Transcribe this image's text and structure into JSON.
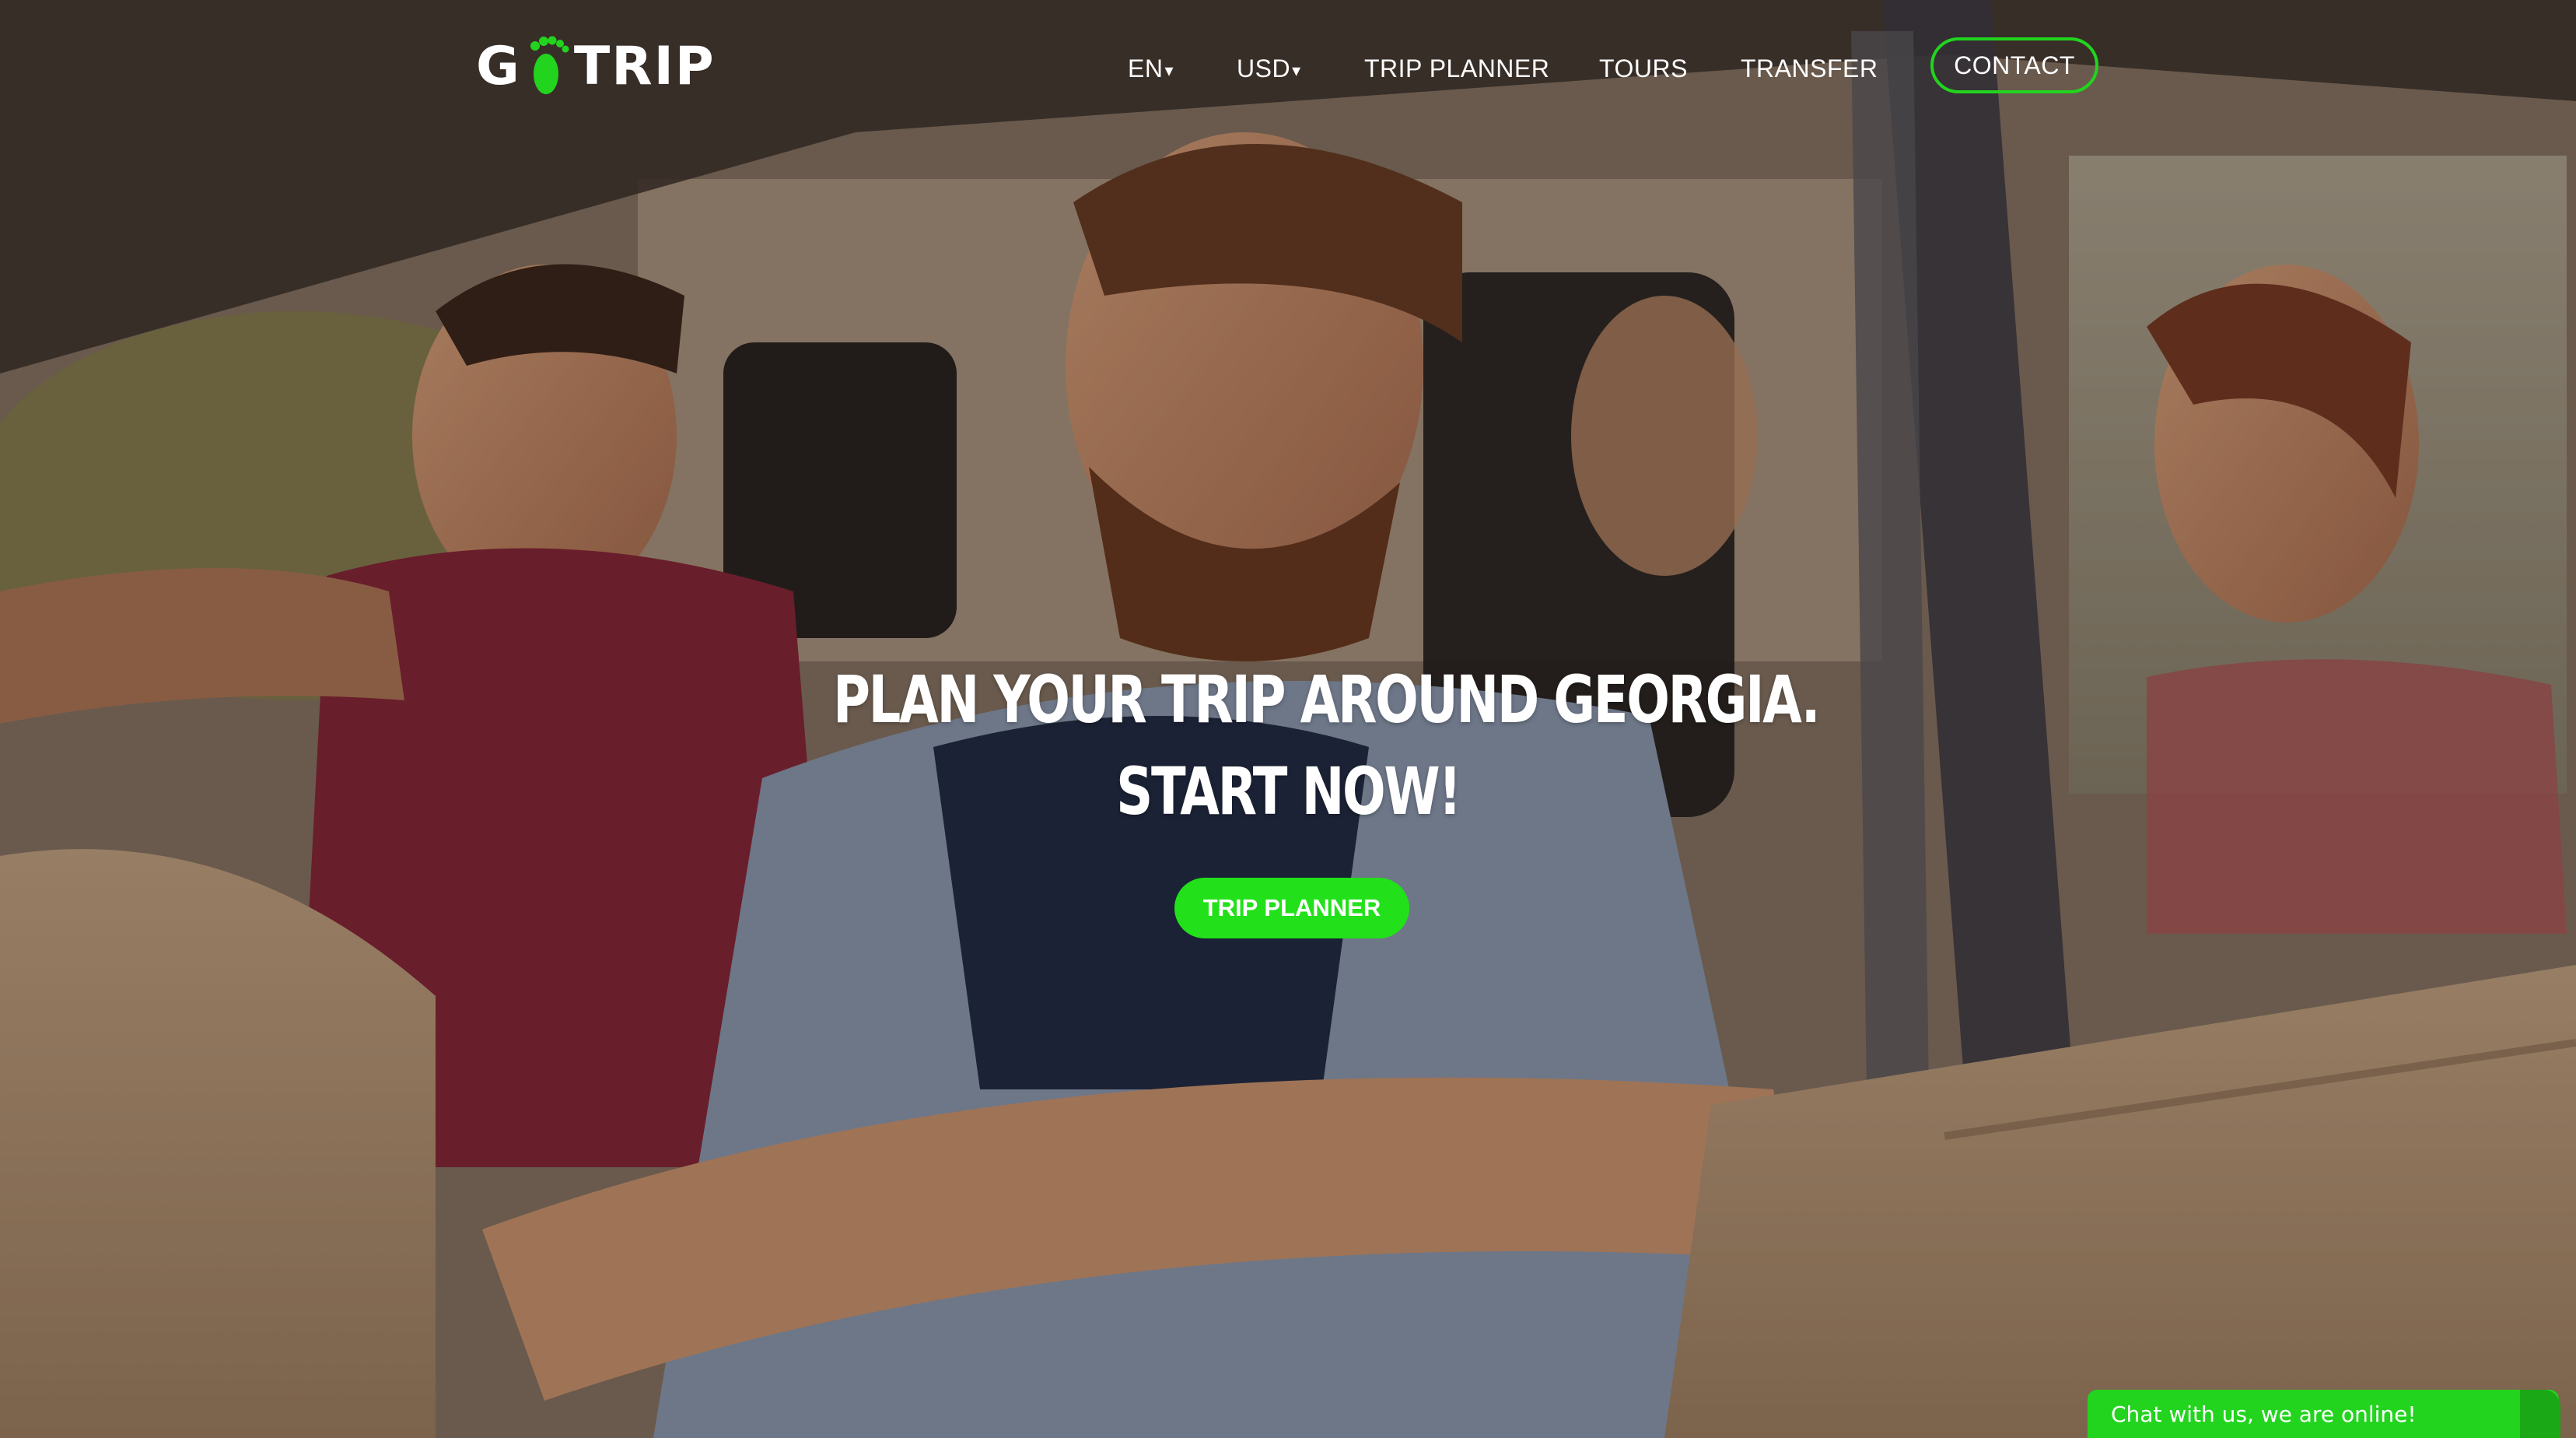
{
  "logo": {
    "letter_g": "G",
    "word_trip": "TRIP",
    "icon": "footprint-icon"
  },
  "nav": {
    "language": "EN",
    "currency": "USD",
    "caret": "▾",
    "trip_planner": "TRIP PLANNER",
    "tours": "TOURS",
    "transfer": "TRANSFER",
    "contact": "CONTACT"
  },
  "hero": {
    "headline_line1": "PLAN YOUR TRIP AROUND GEORGIA.",
    "headline_line2": "START NOW!",
    "cta_label": "TRIP PLANNER"
  },
  "chat": {
    "label": "Chat with us, we are online!"
  },
  "colors": {
    "accent": "#22e11a",
    "text": "#ffffff"
  }
}
